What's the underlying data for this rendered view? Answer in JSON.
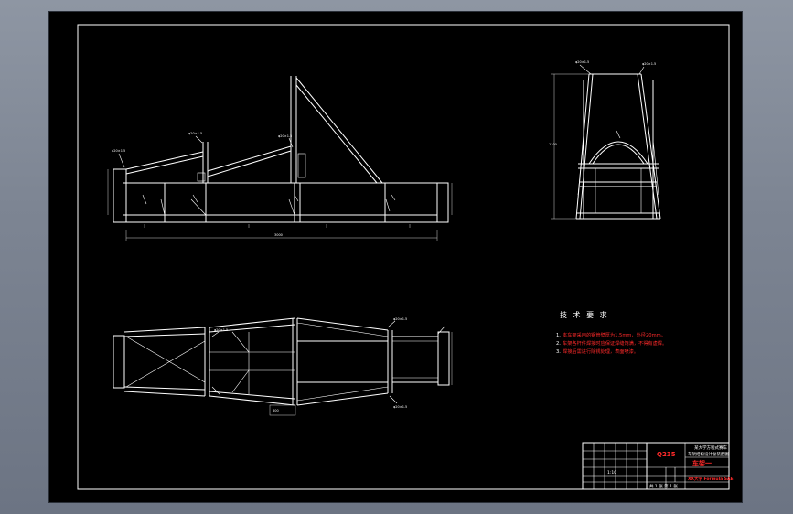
{
  "requirements": {
    "title": "技 术 要 求",
    "items": [
      {
        "num": "1.",
        "text": "本车架采用的钢管壁厚为1.5mm，外径20mm。"
      },
      {
        "num": "2.",
        "text": "车架各杆件焊接时应保证焊缝饱满，不得有虚焊。"
      },
      {
        "num": "3.",
        "text": "焊接后需进行除锈处理，表面喷漆。"
      }
    ]
  },
  "title_block": {
    "material": "Q235",
    "drawing_title_1": "某大学方程式赛车",
    "drawing_title_2": "车架结构设计总装配图",
    "drawing_name": "车架一",
    "scale": "1:10",
    "sheet": "共 1 张  第 1 张",
    "school": "XX大学 Formula SAE"
  },
  "annotations": {
    "side_overall": "3000",
    "top_width": "600",
    "front_height": "1100",
    "front_width": "560",
    "leader_tag": "φ20×1.5"
  }
}
